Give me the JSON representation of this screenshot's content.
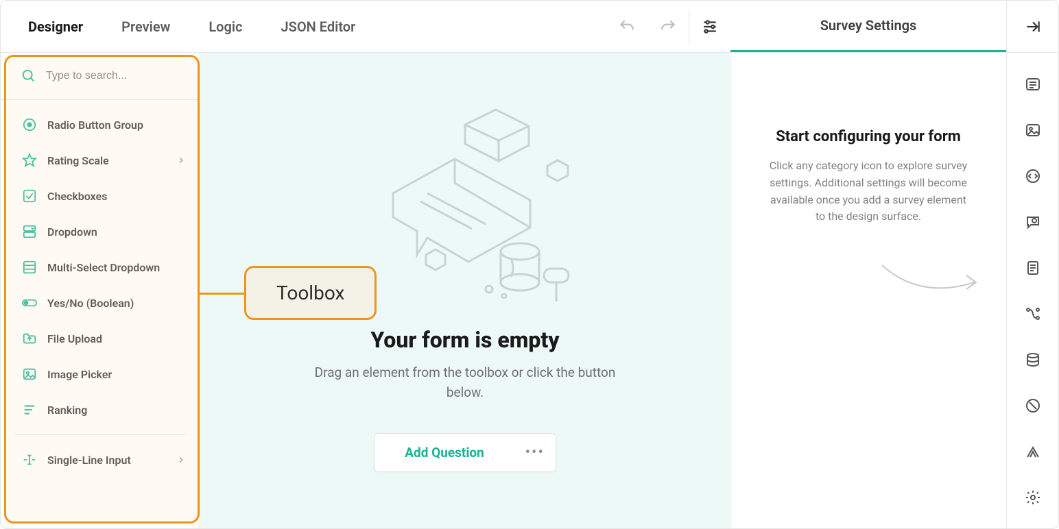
{
  "tabs": [
    {
      "label": "Designer",
      "active": true
    },
    {
      "label": "Preview",
      "active": false
    },
    {
      "label": "Logic",
      "active": false
    },
    {
      "label": "JSON Editor",
      "active": false
    }
  ],
  "settings_header": "Survey Settings",
  "search": {
    "placeholder": "Type to search..."
  },
  "toolbox": {
    "groups": [
      [
        {
          "label": "Radio Button Group",
          "icon": "radio-icon",
          "has_sub": false
        },
        {
          "label": "Rating Scale",
          "icon": "star-icon",
          "has_sub": true
        },
        {
          "label": "Checkboxes",
          "icon": "checkbox-icon",
          "has_sub": false
        },
        {
          "label": "Dropdown",
          "icon": "dropdown-icon",
          "has_sub": false
        },
        {
          "label": "Multi-Select Dropdown",
          "icon": "multiselect-icon",
          "has_sub": false
        },
        {
          "label": "Yes/No (Boolean)",
          "icon": "toggle-icon",
          "has_sub": false
        },
        {
          "label": "File Upload",
          "icon": "upload-icon",
          "has_sub": false
        },
        {
          "label": "Image Picker",
          "icon": "image-icon",
          "has_sub": false
        },
        {
          "label": "Ranking",
          "icon": "ranking-icon",
          "has_sub": false
        }
      ],
      [
        {
          "label": "Single-Line Input",
          "icon": "textline-icon",
          "has_sub": true
        }
      ]
    ]
  },
  "canvas": {
    "title": "Your form is empty",
    "subtitle": "Drag an element from the toolbox or click the button below.",
    "add_label": "Add Question"
  },
  "settings": {
    "title": "Start configuring your form",
    "desc": "Click any category icon to explore survey settings. Additional settings will become available once you add a survey element to the design surface."
  },
  "callout": {
    "label": "Toolbox"
  },
  "rail_icons": [
    "list-icon",
    "picture-icon",
    "embed-icon",
    "gear-chat-icon",
    "doc-icon",
    "path-icon",
    "database-icon",
    "deny-icon",
    "flags-icon",
    "cog-icon"
  ]
}
